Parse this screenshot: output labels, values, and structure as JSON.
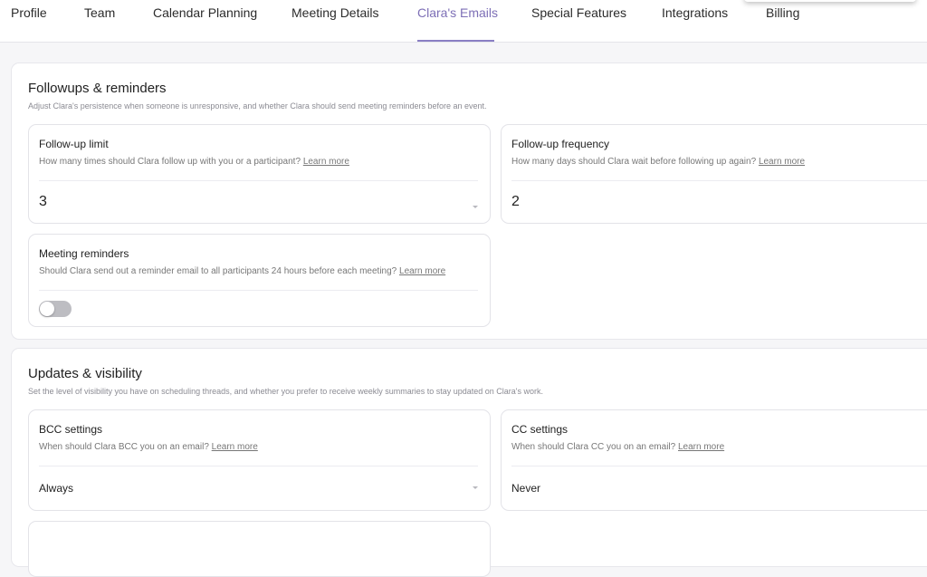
{
  "tabs": [
    {
      "label": "Profile"
    },
    {
      "label": "Team"
    },
    {
      "label": "Calendar Planning"
    },
    {
      "label": "Meeting Details"
    },
    {
      "label": "Clara's Emails",
      "active": true
    },
    {
      "label": "Special Features"
    },
    {
      "label": "Integrations"
    },
    {
      "label": "Billing"
    }
  ],
  "followups": {
    "title": "Followups & reminders",
    "description": "Adjust Clara's persistence when someone is unresponsive, and whether Clara should send meeting reminders before an event.",
    "limit": {
      "title": "Follow-up limit",
      "description": "How many times should Clara follow up with you or a participant?",
      "learn_more": "Learn more",
      "value": "3"
    },
    "frequency": {
      "title": "Follow-up frequency",
      "description": "How many days should Clara wait before following up again?",
      "learn_more": "Learn more",
      "value": "2"
    },
    "reminders": {
      "title": "Meeting reminders",
      "description": "Should Clara send out a reminder email to all participants 24 hours before each meeting?",
      "learn_more": "Learn more",
      "enabled": false
    }
  },
  "updates": {
    "title": "Updates & visibility",
    "description": "Set the level of visibility you have on scheduling threads, and whether you prefer to receive weekly summaries to stay updated on Clara's work.",
    "bcc": {
      "title": "BCC settings",
      "description": "When should Clara BCC you on an email?",
      "learn_more": "Learn more",
      "value": "Always"
    },
    "cc": {
      "title": "CC settings",
      "description": "When should Clara CC you on an email?",
      "learn_more": "Learn more",
      "value": "Never"
    }
  },
  "colors": {
    "accent": "#7d6fb6",
    "toggle_off": "#bdbdc2"
  }
}
